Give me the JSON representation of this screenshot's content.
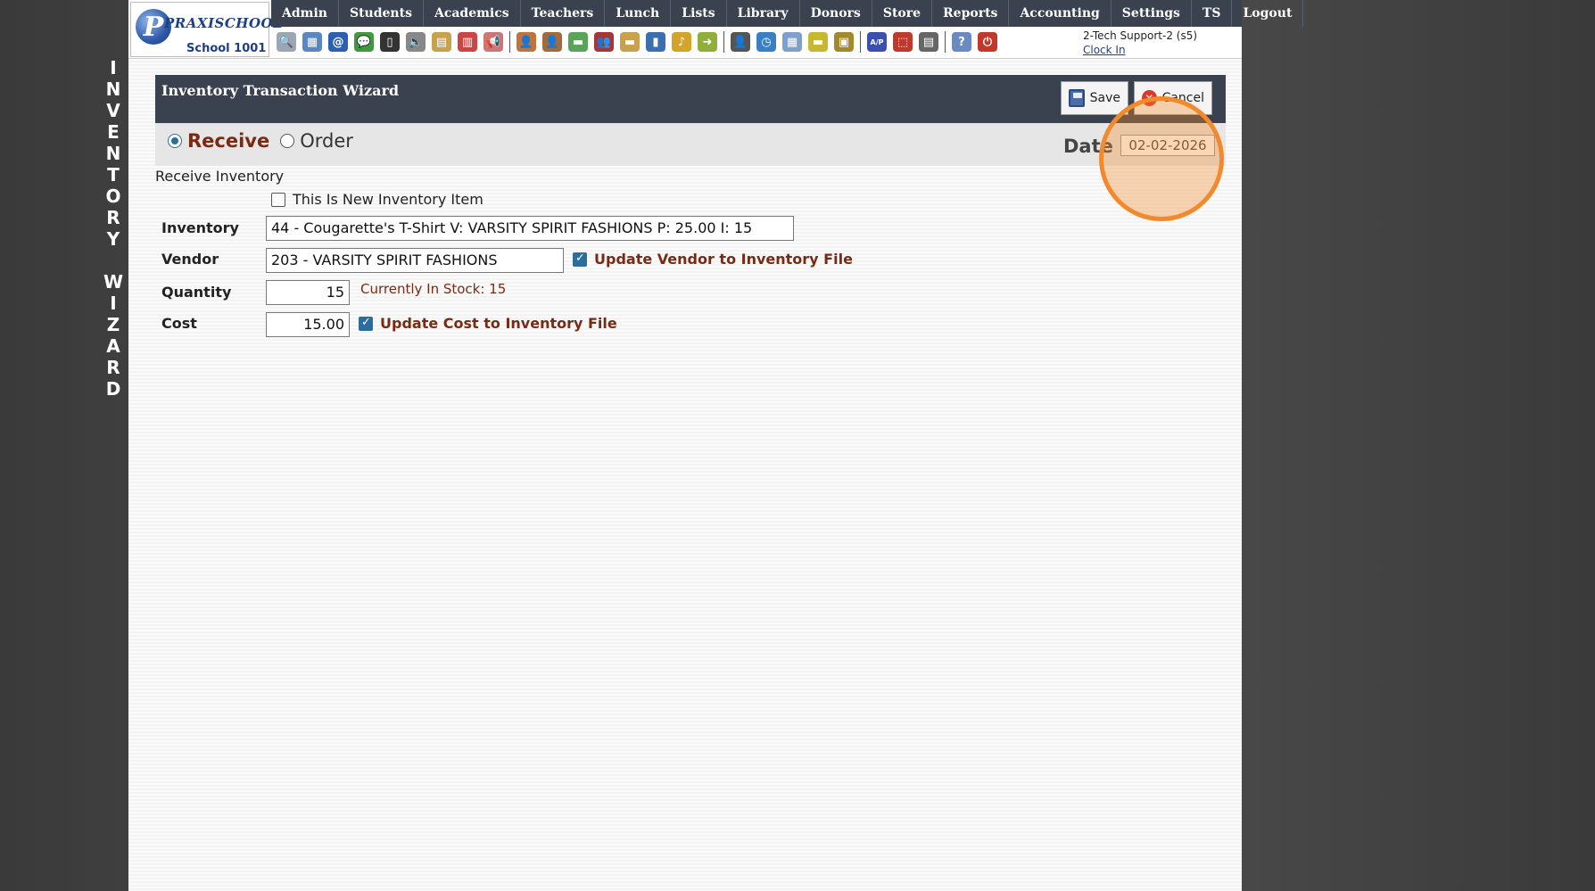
{
  "side_title": [
    "I",
    "N",
    "V",
    "E",
    "N",
    "T",
    "O",
    "R",
    "Y",
    "",
    "W",
    "I",
    "Z",
    "A",
    "R",
    "D"
  ],
  "logo": {
    "mark": "P",
    "brand": "PRAXISCHOOL",
    "school": "School 1001"
  },
  "menu": [
    "Admin",
    "Students",
    "Academics",
    "Teachers",
    "Lunch",
    "Lists",
    "Library",
    "Donors",
    "Store",
    "Reports",
    "Accounting",
    "Settings",
    "TS",
    "Logout"
  ],
  "toolbar_icons": [
    {
      "name": "search-icon",
      "glyph": "🔍",
      "color": "#9aa5b5"
    },
    {
      "name": "calendar-grid-icon",
      "glyph": "▦",
      "color": "#5b86c4"
    },
    {
      "name": "email-icon",
      "glyph": "@",
      "color": "#2b5fb3"
    },
    {
      "name": "chat-icon",
      "glyph": "💬",
      "color": "#3f9a3f"
    },
    {
      "name": "phone-icon",
      "glyph": "▯",
      "color": "#333"
    },
    {
      "name": "speaker-icon",
      "glyph": "🔈",
      "color": "#888"
    },
    {
      "name": "report-card-icon",
      "glyph": "▤",
      "color": "#c9a14d"
    },
    {
      "name": "calendar-icon",
      "glyph": "▥",
      "color": "#c44"
    },
    {
      "name": "megaphone-icon",
      "glyph": "📢",
      "color": "#c77"
    },
    {
      "name": "teacher-icon",
      "glyph": "👤",
      "color": "#c0733a"
    },
    {
      "name": "student-icon",
      "glyph": "👤",
      "color": "#a56a3a"
    },
    {
      "name": "money-icon",
      "glyph": "▬",
      "color": "#5aa35a"
    },
    {
      "name": "parents-icon",
      "glyph": "👥",
      "color": "#a33"
    },
    {
      "name": "lunch-icon",
      "glyph": "▬",
      "color": "#c9a14d"
    },
    {
      "name": "book-icon",
      "glyph": "▮",
      "color": "#3a6fb0"
    },
    {
      "name": "bell-icon",
      "glyph": "♪",
      "color": "#d4a42a"
    },
    {
      "name": "export-icon",
      "glyph": "➜",
      "color": "#8fae3a"
    },
    {
      "name": "staff-icon",
      "glyph": "👤",
      "color": "#555"
    },
    {
      "name": "clock-icon",
      "glyph": "◷",
      "color": "#3a7fc4"
    },
    {
      "name": "spreadsheet-icon",
      "glyph": "▦",
      "color": "#7da0cc"
    },
    {
      "name": "card-icon",
      "glyph": "▬",
      "color": "#c8b830"
    },
    {
      "name": "register-icon",
      "glyph": "▣",
      "color": "#a08a2a"
    },
    {
      "name": "ap-icon",
      "glyph": "A/P",
      "color": "#3a4fb0"
    },
    {
      "name": "pdf-icon",
      "glyph": "⬚",
      "color": "#c0392b"
    },
    {
      "name": "cash-icon",
      "glyph": "▤",
      "color": "#666"
    },
    {
      "name": "help-icon",
      "glyph": "?",
      "color": "#6a8ac4"
    },
    {
      "name": "power-icon",
      "glyph": "⏻",
      "color": "#c0392b"
    }
  ],
  "user": {
    "name": "2-Tech Support-2 (s5)",
    "clock_link": "Clock In"
  },
  "wizard": {
    "title": "Inventory Transaction Wizard",
    "save_label": "Save",
    "cancel_label": "Cancel",
    "mode_receive": "Receive",
    "mode_order": "Order",
    "selected_mode": "Receive",
    "date_label": "Date",
    "date_value": "02-02-2026",
    "section_title": "Receive Inventory",
    "new_item_label": "This Is New Inventory Item",
    "new_item_checked": false,
    "inventory_label": "Inventory",
    "inventory_value": "44 - Cougarette's T-Shirt V: VARSITY SPIRIT FASHIONS P: 25.00 I: 15",
    "vendor_label": "Vendor",
    "vendor_value": "203 - VARSITY SPIRIT FASHIONS",
    "update_vendor_label": "Update Vendor to Inventory File",
    "update_vendor_checked": true,
    "quantity_label": "Quantity",
    "quantity_value": "15",
    "stock_note": "Currently In Stock: 15",
    "cost_label": "Cost",
    "cost_value": "15.00",
    "update_cost_label": "Update Cost to Inventory File",
    "update_cost_checked": true
  },
  "colors": {
    "header_bg": "#3a4250",
    "accent_text": "#7a2a12",
    "highlight": "#f08a2c"
  }
}
